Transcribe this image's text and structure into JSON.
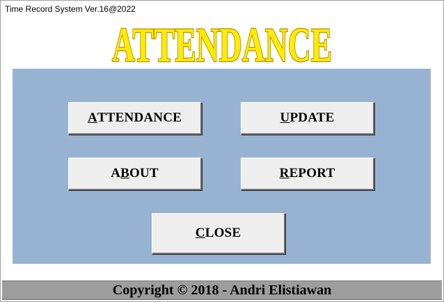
{
  "window": {
    "title": "Time Record System Ver.16@2022"
  },
  "header": {
    "logo_text": "ATTENDANCE",
    "logo_fill": "#ffec00",
    "logo_stroke": "#b08a00"
  },
  "menu": {
    "attendance": {
      "hotkey": "A",
      "rest": "TTENDANCE"
    },
    "update": {
      "hotkey": "U",
      "rest": "PDATE"
    },
    "about": {
      "pre": "A",
      "hotkey": "B",
      "rest": "OUT"
    },
    "report": {
      "hotkey": "R",
      "rest": "EPORT"
    },
    "close": {
      "hotkey": "C",
      "rest": "LOSE"
    }
  },
  "footer": {
    "copyright": "Copyright © 2018 - Andri Elistiawan"
  },
  "colors": {
    "panel": "#97b3d1",
    "button_face": "#eeeeee",
    "footer_bg": "#9d9d9d"
  }
}
